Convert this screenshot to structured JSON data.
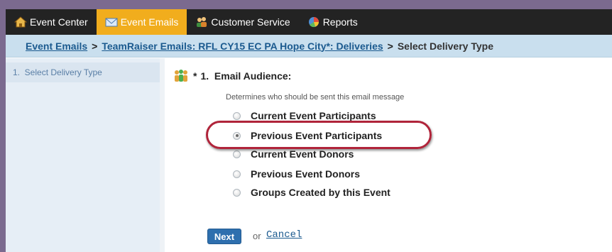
{
  "nav": {
    "tabs": [
      {
        "label": "Event Center",
        "icon": "home-icon"
      },
      {
        "label": "Event Emails",
        "icon": "envelope-icon"
      },
      {
        "label": "Customer Service",
        "icon": "people-icon"
      },
      {
        "label": "Reports",
        "icon": "pie-chart-icon"
      }
    ]
  },
  "breadcrumb": {
    "link1": "Event Emails",
    "sep1": ">",
    "link2": "TeamRaiser Emails: RFL CY15 EC PA Hope City*: Deliveries",
    "sep2": ">",
    "current": "Select Delivery Type"
  },
  "sidebar": {
    "items": [
      {
        "label": "1.  Select Delivery Type"
      }
    ]
  },
  "main": {
    "required_mark": "*",
    "title": "1.  Email Audience:",
    "description": "Determines who should be sent this email message",
    "options": [
      {
        "label": "Current Event Participants",
        "checked": false
      },
      {
        "label": "Previous Event Participants",
        "checked": true
      },
      {
        "label": "Current Event Donors",
        "checked": false
      },
      {
        "label": "Previous Event Donors",
        "checked": false
      },
      {
        "label": "Groups Created by this Event",
        "checked": false
      }
    ],
    "next_label": "Next",
    "or_label": "or",
    "cancel_label": "Cancel"
  },
  "colors": {
    "active_tab": "#f1ad1d",
    "nav_bg": "#232323",
    "breadcrumb_bg": "#c9dfee",
    "highlight": "#b0243a",
    "button": "#2e6fae"
  }
}
